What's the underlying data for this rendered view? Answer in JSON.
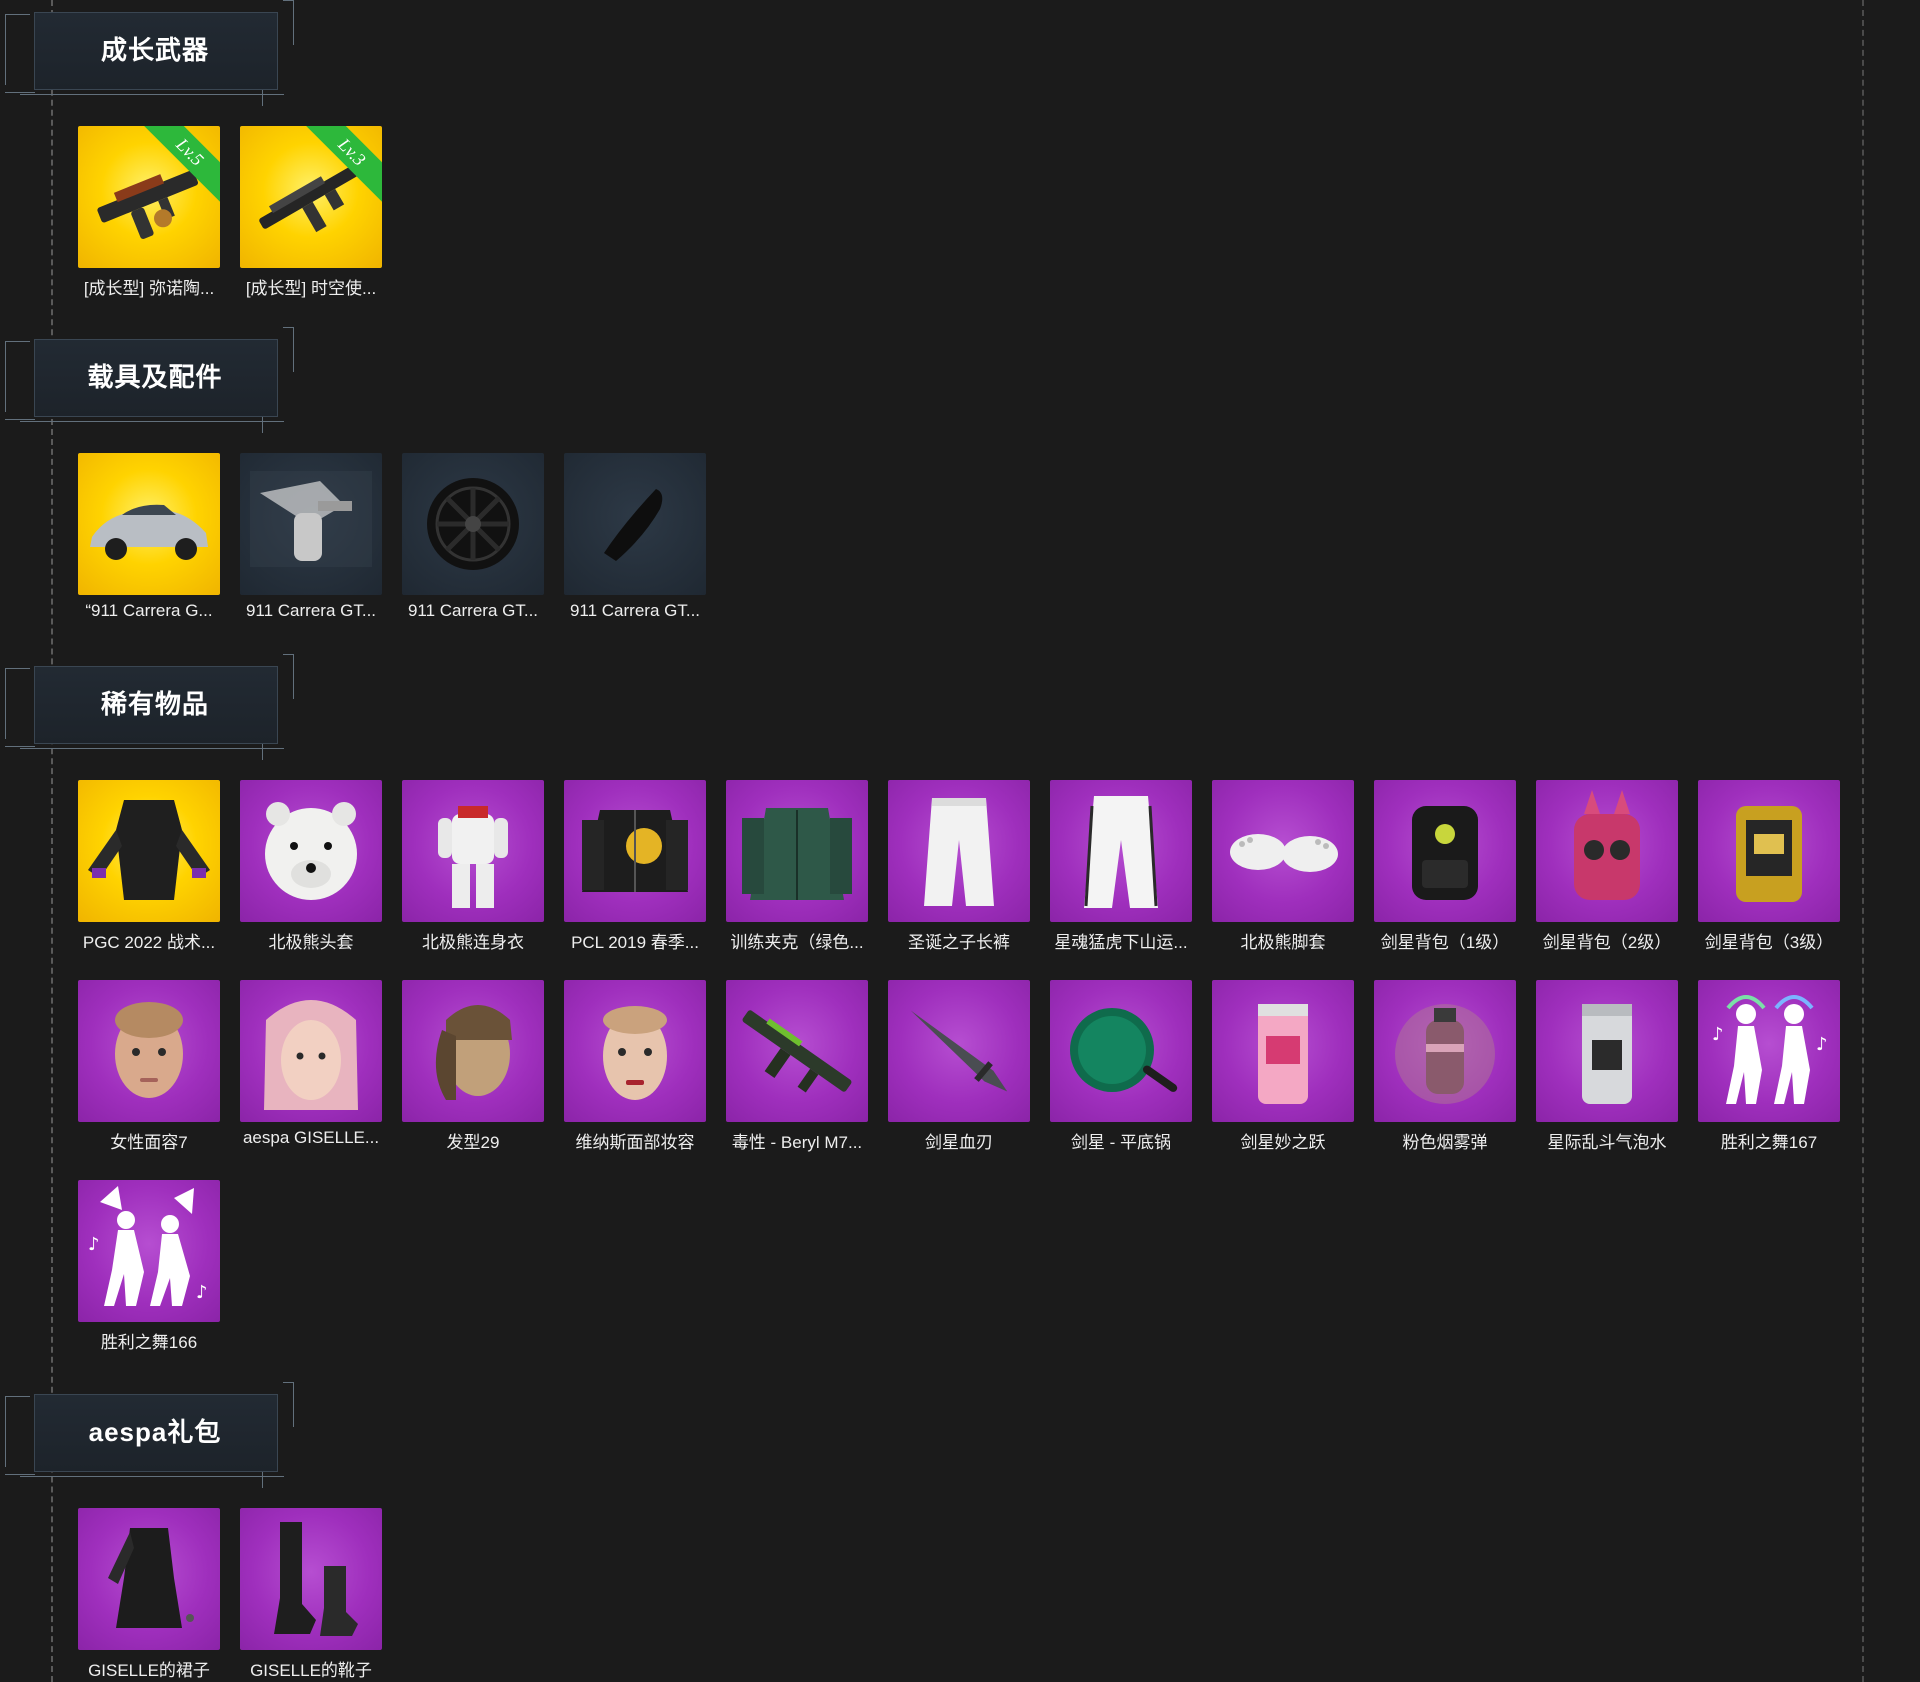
{
  "sections": [
    {
      "title": "成长武器",
      "items": [
        {
          "label": "[成长型] 弥诺陶...",
          "rarity": "gold",
          "icon": "growth-smg-icon",
          "level": "Lv.5"
        },
        {
          "label": "[成长型] 时空使...",
          "rarity": "gold",
          "icon": "growth-rifle-icon",
          "level": "Lv.3"
        }
      ]
    },
    {
      "title": "载具及配件",
      "items": [
        {
          "label": "“911 Carrera G...",
          "rarity": "gold",
          "icon": "sports-car-icon"
        },
        {
          "label": "911 Carrera GT...",
          "rarity": "dark",
          "icon": "spray-gun-icon"
        },
        {
          "label": "911 Carrera GT...",
          "rarity": "dark",
          "icon": "wheel-icon"
        },
        {
          "label": "911 Carrera GT...",
          "rarity": "dark",
          "icon": "car-part-icon"
        }
      ]
    },
    {
      "title": "稀有物品",
      "items": [
        {
          "label": "PGC 2022 战术...",
          "rarity": "gold",
          "icon": "tactical-suit-icon"
        },
        {
          "label": "北极熊头套",
          "rarity": "purple",
          "icon": "polar-bear-head-icon"
        },
        {
          "label": "北极熊连身衣",
          "rarity": "purple",
          "icon": "bear-jumpsuit-icon"
        },
        {
          "label": "PCL 2019 春季...",
          "rarity": "purple",
          "icon": "jacket-icon"
        },
        {
          "label": "训练夹克（绿色...",
          "rarity": "purple",
          "icon": "green-jacket-icon"
        },
        {
          "label": "圣诞之子长裤",
          "rarity": "purple",
          "icon": "white-pants-icon"
        },
        {
          "label": "星魂猛虎下山运...",
          "rarity": "purple",
          "icon": "track-pants-icon"
        },
        {
          "label": "北极熊脚套",
          "rarity": "purple",
          "icon": "bear-feet-icon"
        },
        {
          "label": "剑星背包（1级）",
          "rarity": "purple",
          "icon": "backpack-black-icon"
        },
        {
          "label": "剑星背包（2级）",
          "rarity": "purple",
          "icon": "backpack-pink-icon"
        },
        {
          "label": "剑星背包（3级）",
          "rarity": "purple",
          "icon": "backpack-gold-icon"
        },
        {
          "label": "女性面容7",
          "rarity": "purple",
          "icon": "female-face-icon"
        },
        {
          "label": "aespa GISELLE...",
          "rarity": "purple",
          "icon": "giselle-face-icon"
        },
        {
          "label": "发型29",
          "rarity": "purple",
          "icon": "hairstyle-icon"
        },
        {
          "label": "维纳斯面部妆容",
          "rarity": "purple",
          "icon": "face-makeup-icon"
        },
        {
          "label": "毒性 - Beryl M7...",
          "rarity": "purple",
          "icon": "rifle-icon"
        },
        {
          "label": "剑星血刃",
          "rarity": "purple",
          "icon": "blade-icon"
        },
        {
          "label": "剑星 - 平底锅",
          "rarity": "purple",
          "icon": "pan-icon"
        },
        {
          "label": "剑星妙之跃",
          "rarity": "purple",
          "icon": "soda-can-pink-icon"
        },
        {
          "label": "粉色烟雾弹",
          "rarity": "purple",
          "icon": "smoke-grenade-icon"
        },
        {
          "label": "星际乱斗气泡水",
          "rarity": "purple",
          "icon": "soda-can-silver-icon"
        },
        {
          "label": "胜利之舞167",
          "rarity": "purple",
          "icon": "dance-emote-icon"
        },
        {
          "label": "胜利之舞166",
          "rarity": "purple",
          "icon": "fan-dance-emote-icon"
        }
      ]
    },
    {
      "title": "aespa礼包",
      "items": [
        {
          "label": "GISELLE的裙子",
          "rarity": "purple",
          "icon": "skirt-icon"
        },
        {
          "label": "GISELLE的靴子",
          "rarity": "purple",
          "icon": "boots-icon"
        }
      ]
    }
  ]
}
